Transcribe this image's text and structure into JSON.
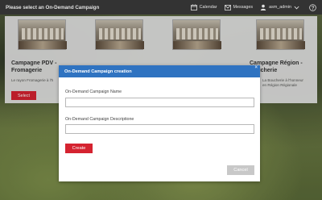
{
  "header": {
    "title": "Please select an On-Demand Campaign",
    "calendar_label": "Calendar",
    "messages_label": "Messages",
    "user_name": "asm_admin"
  },
  "cards": [
    {
      "title_line1": "Campagne PDV -",
      "title_line2": "Fromagerie",
      "description": "Le rayon Fromagerie à l'h",
      "select_label": "Select"
    },
    {
      "title_line1": "",
      "title_line2": "",
      "description": "",
      "select_label": ""
    },
    {
      "title_line1": "",
      "title_line2": "",
      "description": "",
      "select_label": ""
    },
    {
      "title_line1": "Campagne Région -",
      "title_line2": "Boucherie",
      "description_line1": "La Boucherie à l'honneur",
      "description_line2": "en Région Régionale",
      "select_label": "Select"
    }
  ],
  "modal": {
    "title": "On-Demand Campaign creation",
    "close_glyph": "×",
    "name_label": "On-Demand Campaign Name",
    "name_value": "",
    "description_label": "On-Demand Campaign Descriptione",
    "description_value": "",
    "create_label": "Create",
    "cancel_label": "Cancel"
  },
  "colors": {
    "accent_red": "#d52330",
    "modal_header_blue": "#2f73c1",
    "topbar": "#3b3b3b"
  }
}
